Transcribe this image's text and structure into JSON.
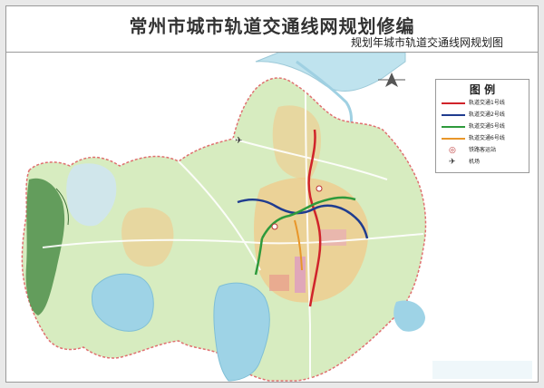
{
  "title": "常州市城市轨道交通线网规划修编",
  "subtitle": "规划年城市轨道交通线网规划图",
  "legend": {
    "title": "图 例",
    "items": [
      {
        "label": "轨道交通1号线",
        "color": "#d0232a"
      },
      {
        "label": "轨道交通2号线",
        "color": "#1f3c8f"
      },
      {
        "label": "轨道交通5号线",
        "color": "#2e9a3c"
      },
      {
        "label": "轨道交通6号线",
        "color": "#e8962a"
      },
      {
        "label": "铁路客运站",
        "icon": "railway-station-icon"
      },
      {
        "label": "机场",
        "icon": "airport-icon"
      }
    ]
  },
  "colors": {
    "water": "#bfe3ee",
    "lake": "#9ed3e6",
    "green_land": "#d7ecc0",
    "forest": "#4f8f4a",
    "urban": "#f2c98a",
    "boundary": "#e07070"
  }
}
